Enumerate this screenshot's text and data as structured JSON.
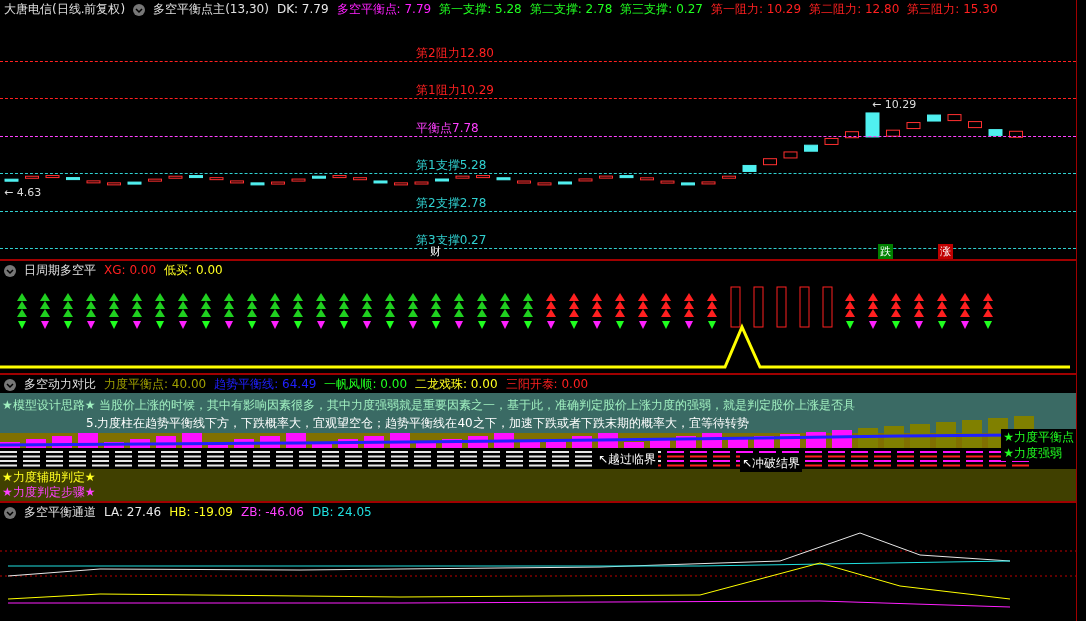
{
  "main_chart": {
    "title": "大唐电信(日线.前复权)",
    "indicator": "多空平衡点主(13,30)",
    "values": [
      {
        "text": "DK: 7.79",
        "color": "#e8e8e8"
      },
      {
        "text": "多空平衡点: 7.79",
        "color": "#ff20ff"
      },
      {
        "text": "第一支撑: 5.28",
        "color": "#20ff20"
      },
      {
        "text": "第二支撑: 2.78",
        "color": "#20ff20"
      },
      {
        "text": "第三支撑: 0.27",
        "color": "#20ff20"
      },
      {
        "text": "第一阻力: 10.29",
        "color": "#ff2020"
      },
      {
        "text": "第二阻力: 12.80",
        "color": "#ff2020"
      },
      {
        "text": "第三阻力: 15.30",
        "color": "#ff2020"
      }
    ],
    "levels": [
      {
        "label": "第2阻力12.80",
        "color": "#ff2020"
      },
      {
        "label": "第1阻力10.29",
        "color": "#ff2020"
      },
      {
        "label": "平衡点7.78",
        "color": "#ff40ff"
      },
      {
        "label": "第1支撑5.28",
        "color": "#30d0d0"
      },
      {
        "label": "第2支撑2.78",
        "color": "#30d0d0"
      },
      {
        "label": "第3支撑0.27",
        "color": "#30d0d0"
      }
    ],
    "price_tags": [
      "← 10.29",
      "← 4.63"
    ],
    "markers": [
      {
        "text": "财",
        "color": "#000000"
      },
      {
        "text": "跌",
        "color": "#008000"
      },
      {
        "text": "涨",
        "color": "#c00000"
      }
    ]
  },
  "cycle_panel": {
    "title": "日周期多空平",
    "values": [
      {
        "text": "XG: 0.00",
        "color": "#ff2020"
      },
      {
        "text": "低买: 0.00",
        "color": "#ffff20"
      }
    ]
  },
  "power_panel": {
    "title": "多空动力对比",
    "values": [
      {
        "text": "力度平衡点: 40.00",
        "color": "#a0a000"
      },
      {
        "text": "趋势平衡线: 64.49",
        "color": "#2020ff"
      },
      {
        "text": "一帆风顺: 0.00",
        "color": "#20ff20"
      },
      {
        "text": "二龙戏珠: 0.00",
        "color": "#ffff20"
      },
      {
        "text": "三阳开泰: 0.00",
        "color": "#ff2020"
      }
    ],
    "notes": [
      {
        "text": "★模型设计思路★ 当股价上涨的时候，其中有影响因素很多，其中力度强弱就是重要因素之一，基于此，准确判定股价上涨力度的强弱，就是判定股价上涨是否具",
        "color": "#a0f0c0"
      },
      {
        "text": "5.力度柱在趋势平衡线下方，下跌概率大，宜观望空仓；趋势平衡线在40之下，加速下跌或者下跌末期的概率大，宜等待转势",
        "color": "#ffffff"
      }
    ],
    "side_labels": [
      "★力度平衡点",
      "★力度强弱"
    ],
    "pointers": [
      "↖越过临界",
      "↖冲破结界"
    ],
    "footer_lines": [
      {
        "text": "★力度辅助判定★",
        "color": "#ffff20"
      },
      {
        "text": "★力度判定步骤★",
        "color": "#ff40ff"
      }
    ]
  },
  "channel_panel": {
    "title": "多空平衡通道",
    "values": [
      {
        "text": "LA: 27.46",
        "color": "#e8e8e8"
      },
      {
        "text": "HB: -19.09",
        "color": "#ffff20"
      },
      {
        "text": "ZB: -46.06",
        "color": "#ff40ff"
      },
      {
        "text": "DB: 24.05",
        "color": "#20e0e0"
      }
    ]
  }
}
